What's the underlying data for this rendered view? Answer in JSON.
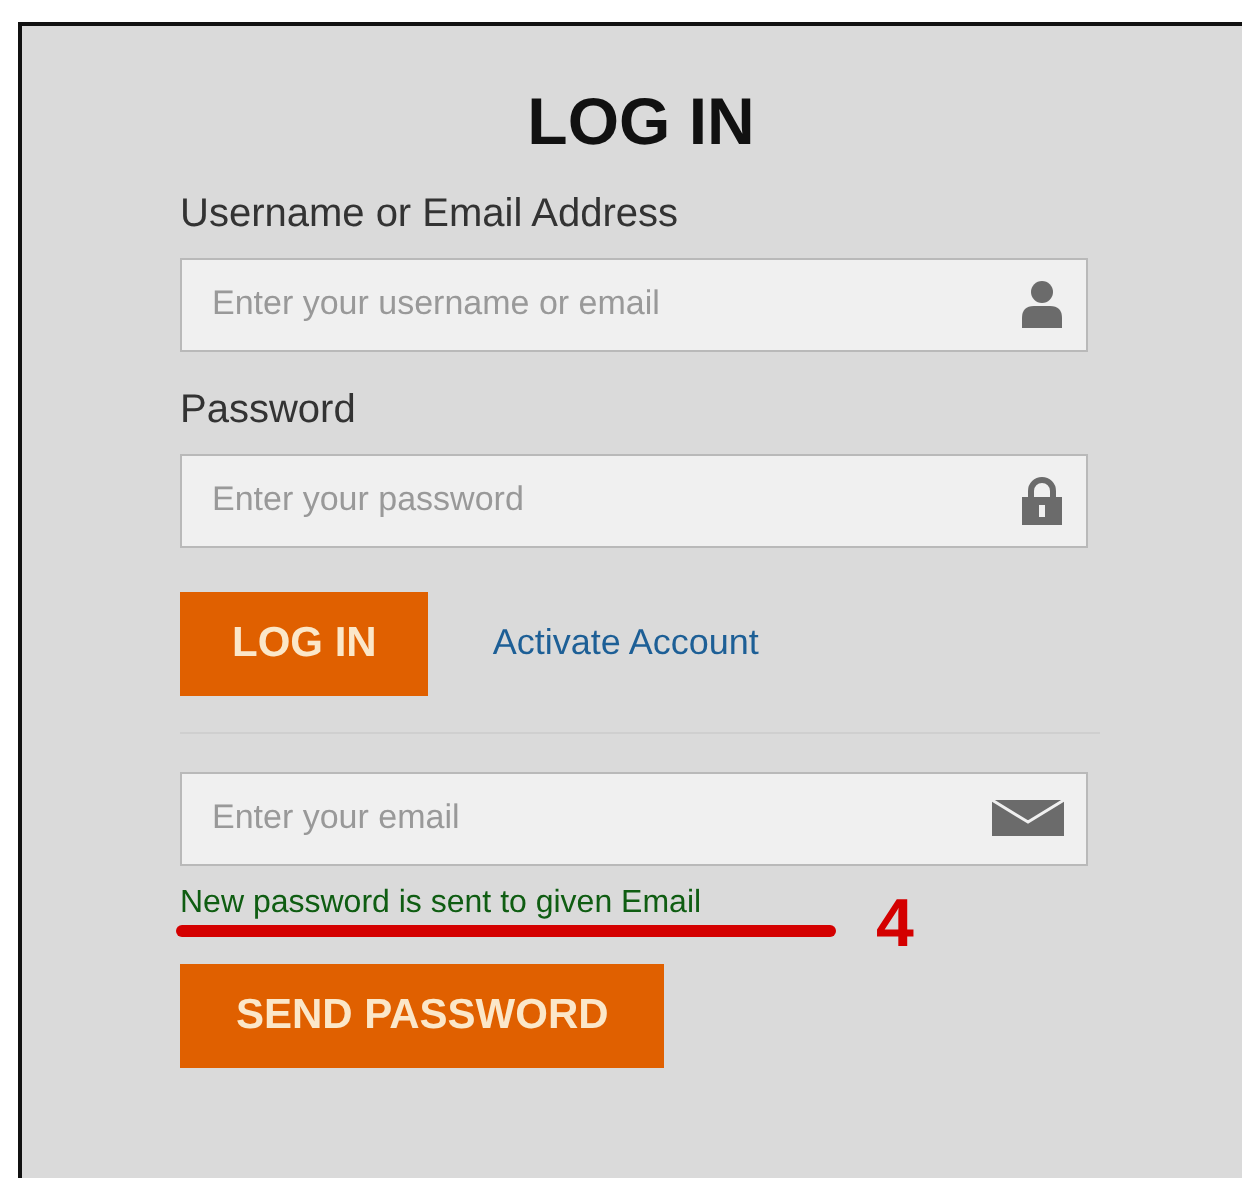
{
  "title": "LOG IN",
  "username": {
    "label": "Username or Email Address",
    "placeholder": "Enter your username or email"
  },
  "password": {
    "label": "Password",
    "placeholder": "Enter your password"
  },
  "login_button": "LOG IN",
  "activate_link": "Activate Account",
  "reset_email": {
    "placeholder": "Enter your email"
  },
  "message": "New password is sent to given Email",
  "annotation": {
    "label": "4"
  },
  "send_button": "SEND PASSWORD"
}
